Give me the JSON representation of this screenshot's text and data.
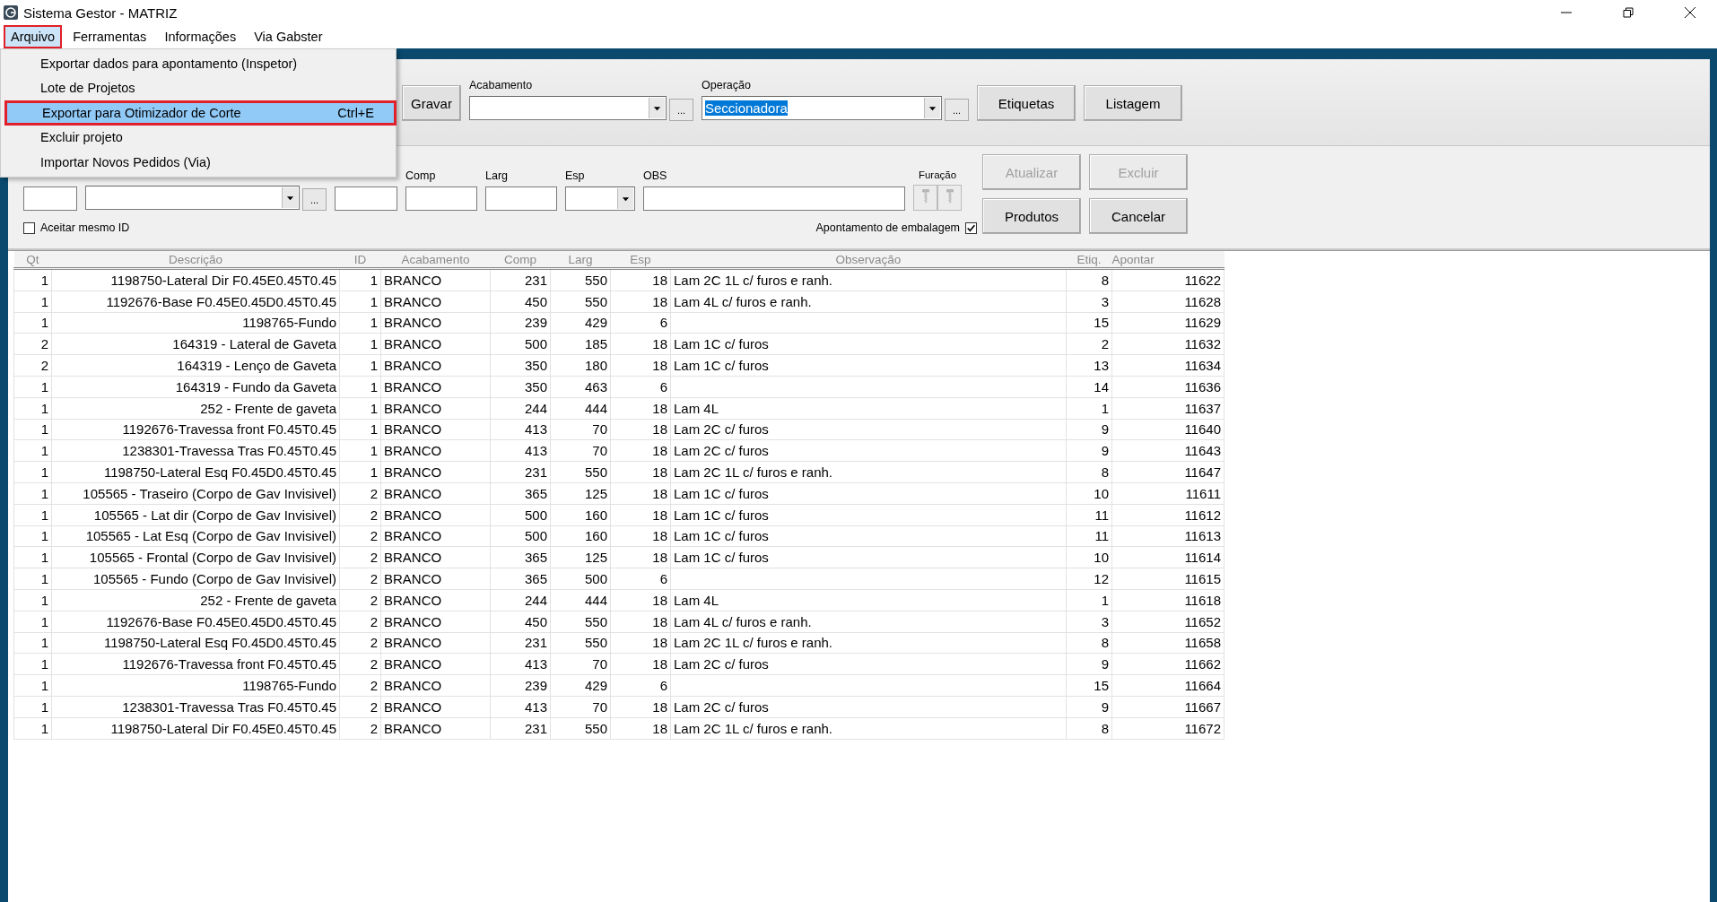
{
  "window": {
    "title": "Sistema Gestor - MATRIZ"
  },
  "menu_bar": [
    {
      "label": "Arquivo",
      "selected": true,
      "marked": true
    },
    {
      "label": "Ferramentas",
      "selected": false,
      "marked": false
    },
    {
      "label": "Informações",
      "selected": false,
      "marked": false
    },
    {
      "label": "Via Gabster",
      "selected": false,
      "marked": false
    }
  ],
  "open_menu": {
    "items": [
      {
        "label": "Exportar dados para apontamento (Inspetor)",
        "selected": false,
        "marked": false
      },
      {
        "label": "Lote de Projetos",
        "selected": false,
        "marked": false
      },
      {
        "label": "Exportar para Otimizador de Corte",
        "shortcut": "Ctrl+E",
        "selected": true,
        "marked": true
      },
      {
        "label": "Excluir projeto",
        "selected": false,
        "marked": false
      },
      {
        "label": "Importar Novos Pedidos (Via)",
        "selected": false,
        "marked": false
      }
    ]
  },
  "toolbar": [
    {
      "kind": "button",
      "label": "Gravar",
      "disabled": false
    },
    {
      "kind": "combo",
      "label": "Acabamento",
      "browse": "..."
    },
    {
      "kind": "combo",
      "label": "Operação",
      "value": "Seccionadora",
      "text_selected": true,
      "browse": "..."
    },
    {
      "kind": "button",
      "label": "Etiquetas",
      "disabled": false
    },
    {
      "kind": "button",
      "label": "Listagem",
      "disabled": false
    }
  ],
  "edit_panel": {
    "fields": [
      {
        "kind": "text"
      },
      {
        "kind": "combo",
        "browse": "..."
      },
      {
        "kind": "text"
      },
      {
        "kind": "text",
        "label": "Comp"
      },
      {
        "kind": "text",
        "label": "Larg"
      },
      {
        "kind": "combo",
        "label": "Esp"
      },
      {
        "kind": "text",
        "label": "OBS"
      },
      {
        "kind": "drills",
        "label": "Furação",
        "disabled": true
      }
    ],
    "checkboxes": [
      {
        "label": "Aceitar mesmo ID",
        "checked": false
      },
      {
        "label": "Apontamento de embalagem",
        "checked": true
      }
    ],
    "buttons": [
      {
        "label": "Atualizar",
        "disabled": true
      },
      {
        "label": "Excluir",
        "disabled": true
      },
      {
        "label": "Produtos",
        "disabled": false
      },
      {
        "label": "Cancelar",
        "disabled": false
      }
    ]
  },
  "table": {
    "columns": [
      {
        "label": "Qt"
      },
      {
        "label": "Descrição"
      },
      {
        "label": "ID"
      },
      {
        "label": "Acabamento"
      },
      {
        "label": "Comp"
      },
      {
        "label": "Larg"
      },
      {
        "label": "Esp"
      },
      {
        "label": "Observação"
      },
      {
        "label": "Etiq."
      },
      {
        "label": "Apontar"
      }
    ],
    "rows": [
      {
        "qt": "1",
        "descricao": "1198750-Lateral Dir F0.45E0.45T0.45",
        "id": "1",
        "acabamento": "BRANCO",
        "comp": "231",
        "larg": "550",
        "esp": "18",
        "observacao": "Lam 2C 1L c/ furos e ranh.",
        "etiq": "8",
        "apontar": "11622"
      },
      {
        "qt": "1",
        "descricao": "1192676-Base F0.45E0.45D0.45T0.45",
        "id": "1",
        "acabamento": "BRANCO",
        "comp": "450",
        "larg": "550",
        "esp": "18",
        "observacao": "Lam 4L c/ furos e ranh.",
        "etiq": "3",
        "apontar": "11628"
      },
      {
        "qt": "1",
        "descricao": "1198765-Fundo",
        "id": "1",
        "acabamento": "BRANCO",
        "comp": "239",
        "larg": "429",
        "esp": "6",
        "etiq": "15",
        "apontar": "11629"
      },
      {
        "qt": "2",
        "descricao": "164319 - Lateral de Gaveta",
        "id": "1",
        "acabamento": "BRANCO",
        "comp": "500",
        "larg": "185",
        "esp": "18",
        "observacao": "Lam 1C c/ furos",
        "etiq": "2",
        "apontar": "11632"
      },
      {
        "qt": "2",
        "descricao": "164319 - Lenço de Gaveta",
        "id": "1",
        "acabamento": "BRANCO",
        "comp": "350",
        "larg": "180",
        "esp": "18",
        "observacao": "Lam 1C c/ furos",
        "etiq": "13",
        "apontar": "11634"
      },
      {
        "qt": "1",
        "descricao": "164319 - Fundo da Gaveta",
        "id": "1",
        "acabamento": "BRANCO",
        "comp": "350",
        "larg": "463",
        "esp": "6",
        "etiq": "14",
        "apontar": "11636"
      },
      {
        "qt": "1",
        "descricao": "252 - Frente de gaveta",
        "id": "1",
        "acabamento": "BRANCO",
        "comp": "244",
        "larg": "444",
        "esp": "18",
        "observacao": "Lam 4L",
        "etiq": "1",
        "apontar": "11637"
      },
      {
        "qt": "1",
        "descricao": "1192676-Travessa front F0.45T0.45",
        "id": "1",
        "acabamento": "BRANCO",
        "comp": "413",
        "larg": "70",
        "esp": "18",
        "observacao": "Lam 2C c/ furos",
        "etiq": "9",
        "apontar": "11640"
      },
      {
        "qt": "1",
        "descricao": "1238301-Travessa Tras F0.45T0.45",
        "id": "1",
        "acabamento": "BRANCO",
        "comp": "413",
        "larg": "70",
        "esp": "18",
        "observacao": "Lam 2C c/ furos",
        "etiq": "9",
        "apontar": "11643"
      },
      {
        "qt": "1",
        "descricao": "1198750-Lateral Esq F0.45D0.45T0.45",
        "id": "1",
        "acabamento": "BRANCO",
        "comp": "231",
        "larg": "550",
        "esp": "18",
        "observacao": "Lam 2C 1L c/ furos e ranh.",
        "etiq": "8",
        "apontar": "11647"
      },
      {
        "qt": "1",
        "descricao": "105565 - Traseiro (Corpo de Gav Invisivel)",
        "id": "2",
        "acabamento": "BRANCO",
        "comp": "365",
        "larg": "125",
        "esp": "18",
        "observacao": "Lam 1C c/ furos",
        "etiq": "10",
        "apontar": "11611"
      },
      {
        "qt": "1",
        "descricao": "105565 - Lat dir (Corpo de Gav Invisivel)",
        "id": "2",
        "acabamento": "BRANCO",
        "comp": "500",
        "larg": "160",
        "esp": "18",
        "observacao": "Lam 1C c/ furos",
        "etiq": "11",
        "apontar": "11612"
      },
      {
        "qt": "1",
        "descricao": "105565 - Lat Esq (Corpo de Gav Invisivel)",
        "id": "2",
        "acabamento": "BRANCO",
        "comp": "500",
        "larg": "160",
        "esp": "18",
        "observacao": "Lam 1C c/ furos",
        "etiq": "11",
        "apontar": "11613"
      },
      {
        "qt": "1",
        "descricao": "105565 - Frontal (Corpo de Gav Invisivel)",
        "id": "2",
        "acabamento": "BRANCO",
        "comp": "365",
        "larg": "125",
        "esp": "18",
        "observacao": "Lam 1C c/ furos",
        "etiq": "10",
        "apontar": "11614"
      },
      {
        "qt": "1",
        "descricao": "105565 - Fundo (Corpo de Gav Invisivel)",
        "id": "2",
        "acabamento": "BRANCO",
        "comp": "365",
        "larg": "500",
        "esp": "6",
        "etiq": "12",
        "apontar": "11615"
      },
      {
        "qt": "1",
        "descricao": "252 - Frente de gaveta",
        "id": "2",
        "acabamento": "BRANCO",
        "comp": "244",
        "larg": "444",
        "esp": "18",
        "observacao": "Lam 4L",
        "etiq": "1",
        "apontar": "11618"
      },
      {
        "qt": "1",
        "descricao": "1192676-Base F0.45E0.45D0.45T0.45",
        "id": "2",
        "acabamento": "BRANCO",
        "comp": "450",
        "larg": "550",
        "esp": "18",
        "observacao": "Lam 4L c/ furos e ranh.",
        "etiq": "3",
        "apontar": "11652"
      },
      {
        "qt": "1",
        "descricao": "1198750-Lateral Esq F0.45D0.45T0.45",
        "id": "2",
        "acabamento": "BRANCO",
        "comp": "231",
        "larg": "550",
        "esp": "18",
        "observacao": "Lam 2C 1L c/ furos e ranh.",
        "etiq": "8",
        "apontar": "11658"
      },
      {
        "qt": "1",
        "descricao": "1192676-Travessa front F0.45T0.45",
        "id": "2",
        "acabamento": "BRANCO",
        "comp": "413",
        "larg": "70",
        "esp": "18",
        "observacao": "Lam 2C c/ furos",
        "etiq": "9",
        "apontar": "11662"
      },
      {
        "qt": "1",
        "descricao": "1198765-Fundo",
        "id": "2",
        "acabamento": "BRANCO",
        "comp": "239",
        "larg": "429",
        "esp": "6",
        "etiq": "15",
        "apontar": "11664"
      },
      {
        "qt": "1",
        "descricao": "1238301-Travessa Tras F0.45T0.45",
        "id": "2",
        "acabamento": "BRANCO",
        "comp": "413",
        "larg": "70",
        "esp": "18",
        "observacao": "Lam 2C c/ furos",
        "etiq": "9",
        "apontar": "11667"
      },
      {
        "qt": "1",
        "descricao": "1198750-Lateral Dir F0.45E0.45T0.45",
        "id": "2",
        "acabamento": "BRANCO",
        "comp": "231",
        "larg": "550",
        "esp": "18",
        "observacao": "Lam 2C 1L c/ furos e ranh.",
        "etiq": "8",
        "apontar": "11672"
      }
    ]
  }
}
